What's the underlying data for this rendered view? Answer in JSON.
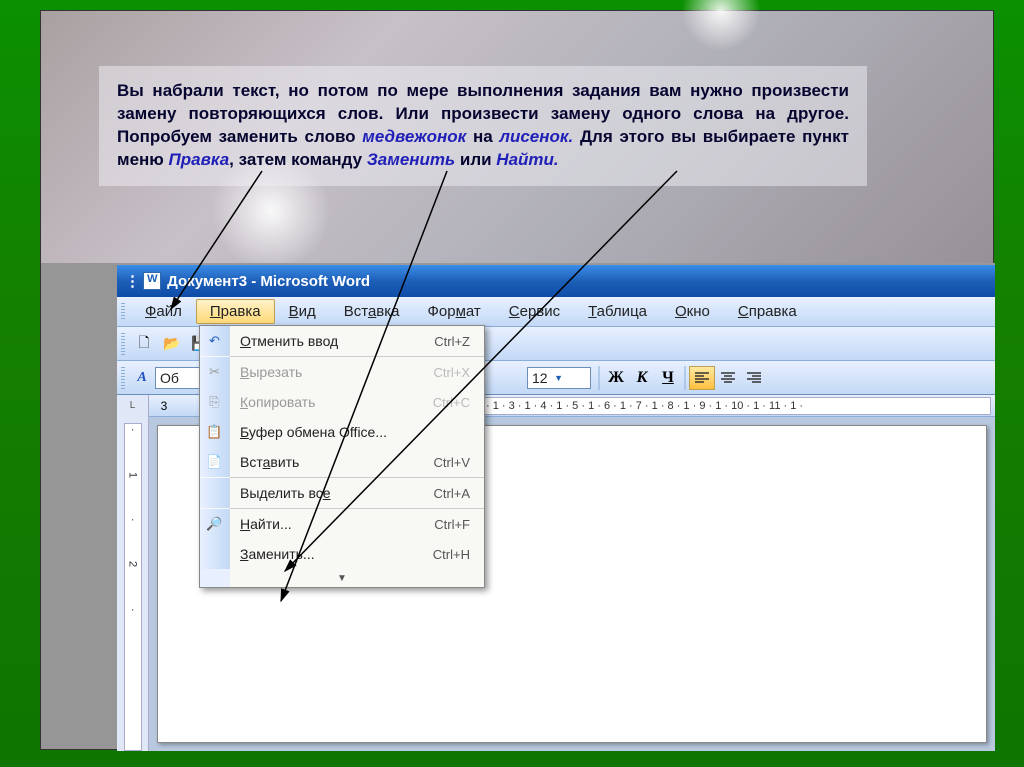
{
  "instruction": {
    "p1": "Вы набрали текст, но потом по мере выполнения задания вам нужно произвести замену повторяющихся слов. Или произвести замену одного слова на другое. Попробуем заменить слово ",
    "word1": "медвежонок",
    "p2": " на ",
    "word2": "лисенок.",
    "p3": " Для этого вы выбираете пункт меню ",
    "menu": "Правка",
    "p4": ", затем команду ",
    "cmd1": "Заменить",
    "or": " или ",
    "cmd2": "Найти."
  },
  "titlebar": {
    "title": "Документ3 - Microsoft Word"
  },
  "menubar": {
    "items": [
      {
        "u": "Ф",
        "rest": "айл"
      },
      {
        "u": "П",
        "rest": "равка"
      },
      {
        "u": "В",
        "rest": "ид"
      },
      {
        "u": "",
        "rest": "Вст",
        "u2": "а",
        "rest2": "вка"
      },
      {
        "u": "",
        "rest": "Фор",
        "u2": "м",
        "rest2": "ат"
      },
      {
        "u": "С",
        "rest": "ервис"
      },
      {
        "u": "Т",
        "rest": "аблица"
      },
      {
        "u": "О",
        "rest": "кно"
      },
      {
        "u": "С",
        "rest": "правка"
      }
    ]
  },
  "dropdown": {
    "items": [
      {
        "icon": "↶",
        "label_pre": "",
        "u": "О",
        "label_post": "тменить ввод",
        "shortcut": "Ctrl+Z",
        "disabled": false
      },
      {
        "sep": true
      },
      {
        "icon": "✂",
        "label_pre": "",
        "u": "В",
        "label_post": "ырезать",
        "shortcut": "Ctrl+X",
        "disabled": true
      },
      {
        "icon": "⎘",
        "label_pre": "",
        "u": "К",
        "label_post": "опировать",
        "shortcut": "Ctrl+C",
        "disabled": true
      },
      {
        "icon": "📋",
        "label_pre": "",
        "u": "Б",
        "label_post": "уфер обмена Office...",
        "shortcut": "",
        "disabled": false
      },
      {
        "icon": "📄",
        "label_pre": "Вст",
        "u": "а",
        "label_post": "вить",
        "shortcut": "Ctrl+V",
        "disabled": false
      },
      {
        "sep": true
      },
      {
        "icon": "",
        "label_pre": "Выделить вс",
        "u": "е",
        "label_post": "",
        "shortcut": "Ctrl+A",
        "disabled": false
      },
      {
        "sep": true
      },
      {
        "icon": "🔍",
        "label_pre": "",
        "u": "Н",
        "label_post": "айти...",
        "shortcut": "Ctrl+F",
        "disabled": false
      },
      {
        "icon": "",
        "label_pre": "",
        "u": "З",
        "label_post": "аменить...",
        "shortcut": "Ctrl+H",
        "disabled": false
      }
    ]
  },
  "toolbar2": {
    "style_trunc": "Об",
    "fontsize": "12",
    "bold": "Ж",
    "italic": "К",
    "under": "Ч"
  },
  "ruler": {
    "left_marker": "3",
    "top_scale": "· 1 · 3 · 1 · 4 · 1 · 5 · 1 · 6 · 1 · 7 · 1 · 8 · 1 · 9 · 1 · 10 · 1 · 11 · 1 ·",
    "left_marks": [
      "·",
      "1",
      "·",
      "2",
      "·"
    ]
  }
}
